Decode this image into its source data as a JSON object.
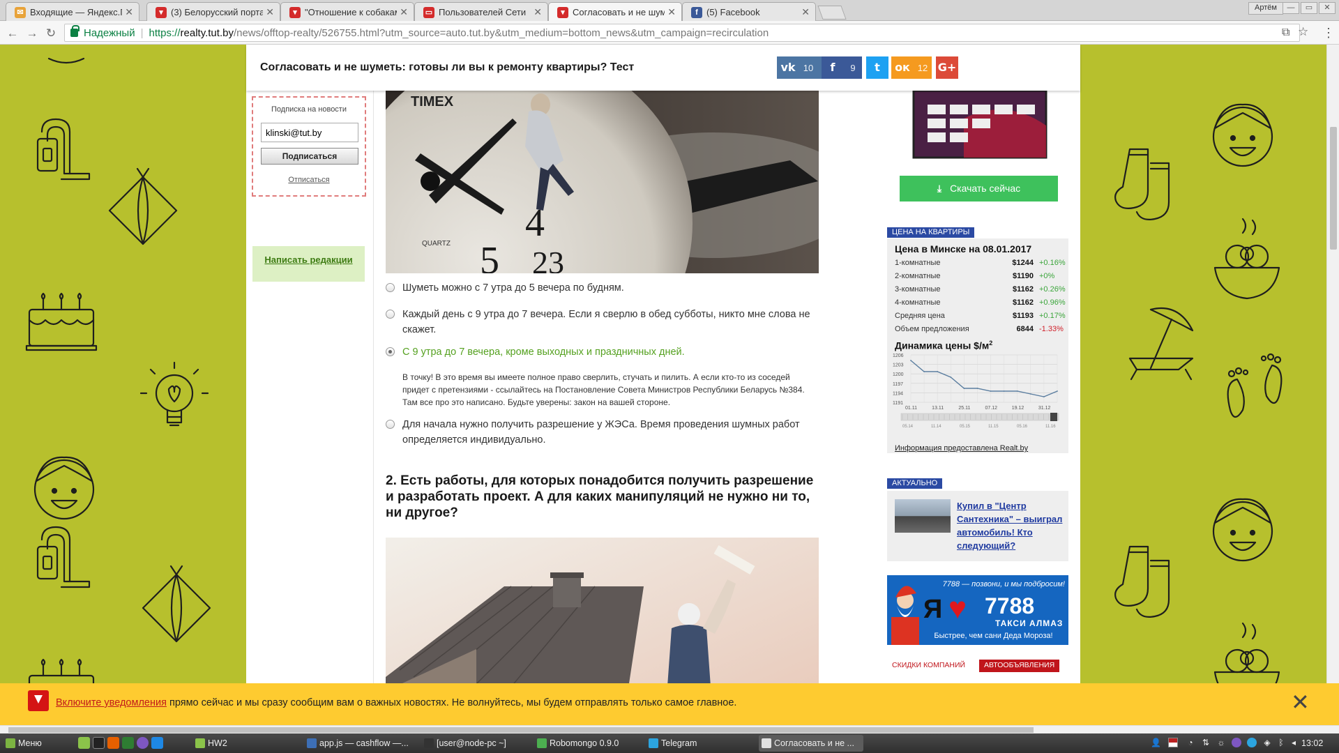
{
  "browser": {
    "tabs": [
      {
        "label": "Входящие — Яндекс.П",
        "color": "#e8a33a",
        "glyph": "✉"
      },
      {
        "label": "(3) Белорусский порта",
        "color": "#d42b2b",
        "glyph": "▾"
      },
      {
        "label": "\"Отношение к собакам",
        "color": "#d42b2b",
        "glyph": "▾"
      },
      {
        "label": "Пользователей Сети",
        "color": "#d42b2b",
        "glyph": "▭"
      },
      {
        "label": "Согласовать и не шум",
        "color": "#d42b2b",
        "glyph": "▾"
      },
      {
        "label": "(5) Facebook",
        "color": "#3b5998",
        "glyph": "f"
      }
    ],
    "user": "Артём",
    "secure_label": "Надежный",
    "url_scheme": "https://",
    "url_host": "realty.tut.by",
    "url_rest": "/news/offtop-realty/526755.html?utm_source=auto.tut.by&utm_medium=bottom_news&utm_campaign=recirculation"
  },
  "sticky": {
    "title": "Согласовать и не шуметь: готовы ли вы к ремонту квартиры? Тест",
    "shares": [
      {
        "network": "vk",
        "glyph": "vk",
        "count": "10",
        "color": "#4c75a3"
      },
      {
        "network": "facebook",
        "glyph": "f",
        "count": "9",
        "color": "#3b5998"
      },
      {
        "network": "twitter",
        "glyph": "t",
        "count": "",
        "color": "#1da1f2"
      },
      {
        "network": "odnoklassniki",
        "glyph": "ок",
        "count": "12",
        "color": "#f59a1f"
      },
      {
        "network": "google-plus",
        "glyph": "G+",
        "count": "",
        "color": "#dc4a38"
      }
    ]
  },
  "subscribe": {
    "title": "Подписка на новости",
    "email": "klinski@tut.by",
    "button": "Подписаться",
    "unsubscribe": "Отписаться",
    "write_editors": "Написать редакции"
  },
  "quiz": {
    "answers": [
      {
        "text": "Шуметь можно с 7 утра до 5 вечера по будням.",
        "checked": false,
        "correct": false
      },
      {
        "text": "Каждый день с 9 утра до 7 вечера. Если я сверлю в обед субботы, никто мне слова не скажет.",
        "checked": false,
        "correct": false
      },
      {
        "text": "С 9 утра до 7 вечера, кроме выходных и праздничных дней.",
        "checked": true,
        "correct": true
      },
      {
        "text": "Для начала нужно получить разрешение у ЖЭСа. Время проведения шумных работ определяется индивидуально.",
        "checked": false,
        "correct": false
      }
    ],
    "explanation": "В точку! В это время вы имеете полное право сверлить, стучать и пилить. А если кто-то из соседей придет с претензиями - ссылайтесь на Постановление Совета Министров Республики Беларусь №384. Там все про это написано. Будьте уверены: закон на вашей стороне.",
    "question2": "2. Есть работы, для которых понадобится получить разрешение и разработать проект. А для каких манипуляций не нужно ни то, ни другое?",
    "image1_brand": "TIMEX",
    "image1_quartz": "QUARTZ"
  },
  "sidebar": {
    "download_button": "Скачать сейчас",
    "price_label": "ЦЕНА НА КВАРТИРЫ",
    "price_title": "Цена в Минске на 08.01.2017",
    "price_rows": [
      {
        "name": "1-комнатные",
        "value": "$1244",
        "change": "+0.16%",
        "dir": "up"
      },
      {
        "name": "2-комнатные",
        "value": "$1190",
        "change": "+0%",
        "dir": "up"
      },
      {
        "name": "3-комнатные",
        "value": "$1162",
        "change": "+0.26%",
        "dir": "up"
      },
      {
        "name": "4-комнатные",
        "value": "$1162",
        "change": "+0.96%",
        "dir": "up"
      },
      {
        "name": "Средняя цена",
        "value": "$1193",
        "change": "+0.17%",
        "dir": "up"
      },
      {
        "name": "Объем предложения",
        "value": "6844",
        "change": "-1.33%",
        "dir": "down"
      }
    ],
    "dynamics_title": "Динамика цены $/м",
    "dynamics_sup": "2",
    "realt_link": "Информация предоставлена Realt.by",
    "actual_label": "АКТУАЛЬНО",
    "news_link": "Купил в \"Центр Сантехника\" – выиграл автомобиль! Кто следующий?",
    "taxi": {
      "top": "7788 — позвони, и мы подбросим!",
      "ya": "Я",
      "number": "7788",
      "sub": "ТАКСИ АЛМАЗ",
      "bottom": "Быстрее, чем сани Деда Мороза!"
    },
    "bottom_tabs": [
      "СКИДКИ КОМПАНИЙ",
      "АВТООБЪЯВЛЕНИЯ"
    ]
  },
  "chart_data": {
    "type": "line",
    "title": "Динамика цены $/м2",
    "x": [
      "01.11",
      "",
      "13.11",
      "",
      "25.11",
      "",
      "07.12",
      "",
      "19.12",
      "",
      "31.12",
      ""
    ],
    "values": [
      1205,
      1201,
      1201,
      1199,
      1195,
      1195,
      1194,
      1194,
      1194,
      1193,
      1192,
      1194
    ],
    "yticks": [
      "1206",
      "1203",
      "1200",
      "1197",
      "1194",
      "1191"
    ],
    "ylim": [
      1190,
      1207
    ],
    "xlabels": [
      "01.11",
      "13.11",
      "25.11",
      "07.12",
      "19.12",
      "31.12"
    ],
    "range_labels": [
      "05.14",
      "11.14",
      "05.15",
      "11.15",
      "05.16",
      "11.16"
    ],
    "grid": true
  },
  "notification": {
    "link": "Включите уведомления",
    "text": " прямо сейчас и мы сразу сообщим вам о важных новостях. Не волнуйтесь, мы будем отправлять только самое главное."
  },
  "taskbar": {
    "menu": "Меню",
    "windows": [
      {
        "label": "HW2",
        "color": "#8bc34a"
      },
      {
        "label": "app.js — cashflow —...",
        "color": "#3d6fb6"
      },
      {
        "label": "[user@node-pc ~]",
        "color": "#333"
      },
      {
        "label": "Robomongo 0.9.0",
        "color": "#4caf50"
      },
      {
        "label": "Telegram",
        "color": "#2ca5e0"
      },
      {
        "label": "Согласовать и не ...",
        "color": "#e0e0e0"
      }
    ],
    "clock": "13:02"
  }
}
